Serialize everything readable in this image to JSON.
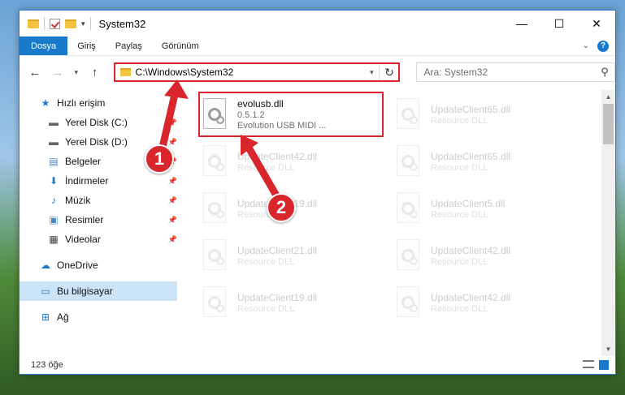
{
  "window": {
    "title": "System32",
    "controls": {
      "minimize": "—",
      "maximize": "☐",
      "close": "✕"
    }
  },
  "ribbon": {
    "tabs": [
      "Dosya",
      "Giriş",
      "Paylaş",
      "Görünüm"
    ]
  },
  "navigation": {
    "address_path": "C:\\Windows\\System32",
    "search_placeholder": "Ara: System32"
  },
  "sidebar": {
    "quick_access": "Hızlı erişim",
    "items": [
      {
        "label": "Yerel Disk (C:)",
        "icon": "drive-icon"
      },
      {
        "label": "Yerel Disk (D:)",
        "icon": "drive-icon"
      },
      {
        "label": "Belgeler",
        "icon": "documents-icon"
      },
      {
        "label": "İndirmeler",
        "icon": "download-icon"
      },
      {
        "label": "Müzik",
        "icon": "music-icon"
      },
      {
        "label": "Resimler",
        "icon": "pictures-icon"
      },
      {
        "label": "Videolar",
        "icon": "videos-icon"
      }
    ],
    "onedrive": "OneDrive",
    "this_pc": "Bu bilgisayar",
    "network": "Ağ"
  },
  "files": {
    "highlighted": {
      "name": "evolusb.dll",
      "version": "0.5.1.2",
      "description": "Evolution USB MIDI ..."
    },
    "col1": [
      {
        "name": "UpdateClient42.dll",
        "description": "Resource DLL"
      },
      {
        "name": "UpdateClient19.dll",
        "description": "Resource DLL"
      },
      {
        "name": "UpdateClient21.dll",
        "description": "Resource DLL"
      },
      {
        "name": "UpdateClient19.dll",
        "description": "Resource DLL"
      }
    ],
    "col2": [
      {
        "name": "UpdateClient65.dll",
        "description": "Resource DLL"
      },
      {
        "name": "UpdateClient65.dll",
        "description": "Resource DLL"
      },
      {
        "name": "UpdateClient5.dll",
        "description": "Resource DLL"
      },
      {
        "name": "UpdateClient42.dll",
        "description": "Resource DLL"
      },
      {
        "name": "UpdateClient42.dll",
        "description": "Resource DLL"
      }
    ]
  },
  "status": {
    "item_count": "123 öğe"
  },
  "callouts": [
    "1",
    "2"
  ],
  "colors": {
    "accent": "#1979ca",
    "highlight": "#d9252c",
    "selection": "#cce4f7"
  }
}
